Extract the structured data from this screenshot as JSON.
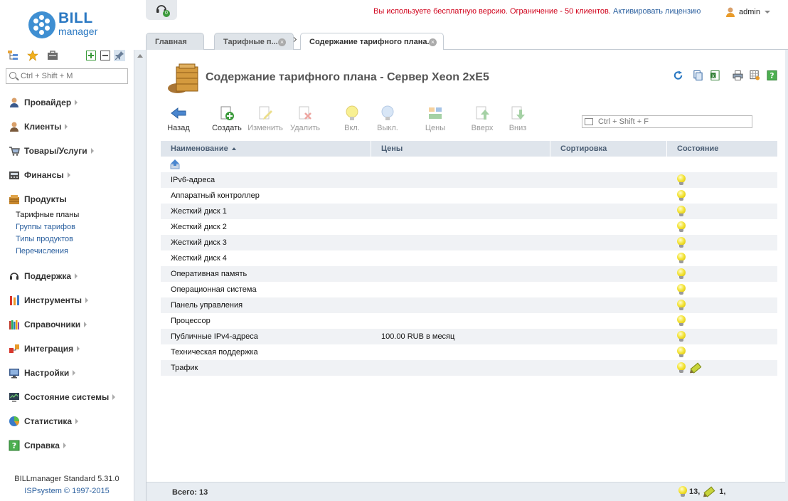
{
  "logo": {
    "line1": "BILL",
    "line2": "manager"
  },
  "sidebar": {
    "search_placeholder": "Ctrl + Shift + M",
    "tools": [
      "tree-icon",
      "star-icon",
      "briefcase-icon",
      "expand-icon",
      "collapse-icon",
      "pin-icon"
    ],
    "items": [
      {
        "label": "Провайдер",
        "icon": "provider-icon"
      },
      {
        "label": "Клиенты",
        "icon": "clients-icon"
      },
      {
        "label": "Товары/Услуги",
        "icon": "cart-icon"
      },
      {
        "label": "Финансы",
        "icon": "finance-icon"
      },
      {
        "label": "Продукты",
        "icon": "products-icon"
      },
      {
        "label": "Поддержка",
        "icon": "headset-icon"
      },
      {
        "label": "Инструменты",
        "icon": "tools-icon"
      },
      {
        "label": "Справочники",
        "icon": "books-icon"
      },
      {
        "label": "Интеграция",
        "icon": "integration-icon"
      },
      {
        "label": "Настройки",
        "icon": "settings-icon"
      },
      {
        "label": "Состояние системы",
        "icon": "monitor-icon"
      },
      {
        "label": "Статистика",
        "icon": "pie-chart-icon"
      },
      {
        "label": "Справка",
        "icon": "help-icon"
      }
    ],
    "products_sub": [
      "Тарифные планы",
      "Группы тарифов",
      "Типы продуктов",
      "Перечисления"
    ],
    "footer_version": "BILLmanager Standard 5.31.0",
    "footer_copyright": "ISPsystem © 1997-2015"
  },
  "topbar": {
    "support_badge": "0",
    "notice": "Вы используете бесплатную версию. Ограничение - 50 клиентов.",
    "license_link": "Активировать лицензию",
    "user": "admin"
  },
  "tabs": [
    {
      "label": "Главная"
    },
    {
      "label": "Тарифные п..."
    },
    {
      "label": "Содержание тарифного плана..."
    }
  ],
  "page": {
    "title": "Содержание тарифного плана - Сервер Xeon 2xE5",
    "search_placeholder": "Ctrl + Shift + F"
  },
  "toolbar": [
    {
      "label": "Назад",
      "enabled": true
    },
    {
      "label": "Создать",
      "enabled": true
    },
    {
      "label": "Изменить",
      "enabled": false
    },
    {
      "label": "Удалить",
      "enabled": false
    },
    {
      "label": "Вкл.",
      "enabled": false
    },
    {
      "label": "Выкл.",
      "enabled": false
    },
    {
      "label": "Цены",
      "enabled": false
    },
    {
      "label": "Вверх",
      "enabled": false
    },
    {
      "label": "Вниз",
      "enabled": false
    }
  ],
  "table": {
    "columns": [
      "Наименование",
      "Цены",
      "Сортировка",
      "Состояние"
    ],
    "rows": [
      {
        "name": "IPv6-адреса",
        "price": ""
      },
      {
        "name": "Аппаратный контроллер",
        "price": ""
      },
      {
        "name": "Жесткий диск 1",
        "price": ""
      },
      {
        "name": "Жесткий диск 2",
        "price": ""
      },
      {
        "name": "Жесткий диск 3",
        "price": ""
      },
      {
        "name": "Жесткий диск 4",
        "price": ""
      },
      {
        "name": "Оперативная память",
        "price": ""
      },
      {
        "name": "Операционная система",
        "price": ""
      },
      {
        "name": "Панель управления",
        "price": ""
      },
      {
        "name": "Процессор",
        "price": ""
      },
      {
        "name": "Публичные IPv4-адреса",
        "price": "100.00 RUB в месяц"
      },
      {
        "name": "Техническая поддержка",
        "price": ""
      },
      {
        "name": "Трафик",
        "price": "",
        "edited": true
      }
    ]
  },
  "status": {
    "total": "Всего: 13",
    "active_count": "13,",
    "edited_count": "1,"
  }
}
